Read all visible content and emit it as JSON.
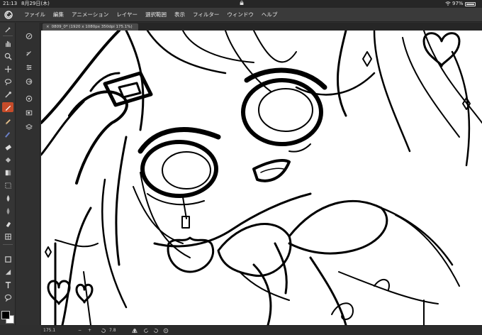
{
  "status_bar": {
    "time": "21:13",
    "date": "8月29日(木)",
    "battery_percent": "97%",
    "battery_level": 0.97
  },
  "menu": {
    "items": [
      "ファイル",
      "編集",
      "アニメーション",
      "レイヤー",
      "選択範囲",
      "表示",
      "フィルター",
      "ウィンドウ",
      "ヘルプ"
    ]
  },
  "document": {
    "tab_title": "0809_0* (1920 x 1080px 350dpi 175.1%)",
    "close_glyph": "×"
  },
  "bottom_bar": {
    "zoom": "175.1",
    "minus": "−",
    "plus": "+",
    "angle": "7.8"
  },
  "colors": {
    "accent": "#c64c2a",
    "foreground": "#000000",
    "background": "#ffffff",
    "chrome": "#3a3a3a"
  },
  "toolbar_icons": [
    "brush-settings-icon",
    "hand-icon",
    "zoom-icon",
    "move-icon",
    "lasso-icon",
    "eyedropper-icon",
    "pen-icon",
    "pencil-icon",
    "ink-brush-icon",
    "eraser-icon",
    "fill-icon",
    "gradient-icon",
    "blend-icon",
    "watercolor-icon",
    "airbrush-icon",
    "decorate-icon",
    "frame-icon",
    "figure-icon",
    "text-icon",
    "balloon-icon",
    "correct-line-icon"
  ]
}
